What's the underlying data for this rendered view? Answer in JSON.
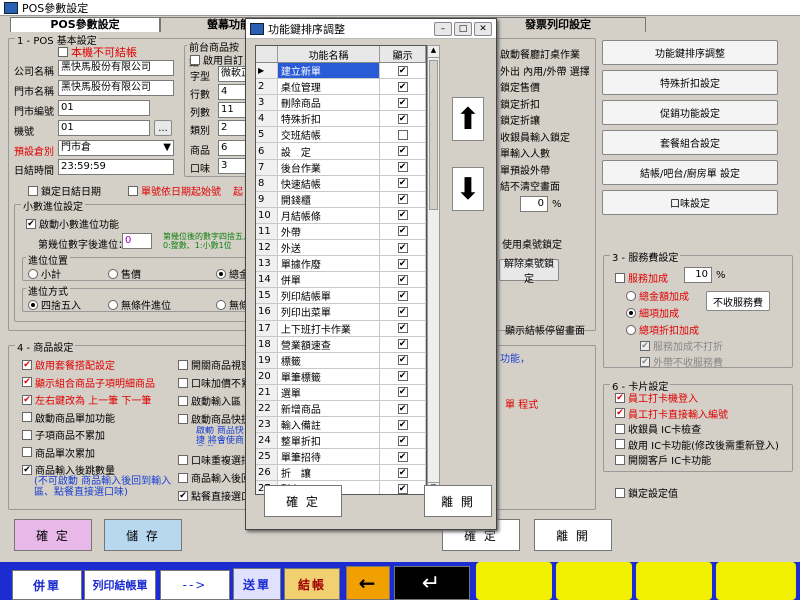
{
  "window": {
    "title": "POS參數設定"
  },
  "tabs": [
    "POS參數設定",
    "螢幕功能設定",
    "",
    "發票列印設定"
  ],
  "section1": {
    "title": "1 - POS 基本設定",
    "not_branch": "本機不可結帳",
    "company_label": "公司名稱",
    "company_value": "黑快馬股份有限公司",
    "store_label": "門市名稱",
    "store_value": "黑快馬股份有限公司",
    "store_no_label": "門市編號",
    "store_no_value": "01",
    "machine_label": "機號",
    "machine_value": "01",
    "warehouse_label": "預設倉別",
    "warehouse_value": "門市倉",
    "daytime_label": "日結時間",
    "daytime_value": "23:59:59",
    "lock_day": "鎖定日結日期",
    "order_day_no": "單號依日期起始號",
    "front_title": "前台商品按鈕",
    "enable_custom": "啟用自訂",
    "font_label": "字型",
    "font_value": "微軟正",
    "rows_label": "行數",
    "rows_value": "4",
    "cols_label": "列數",
    "cols_value": "11",
    "class_label": "類別",
    "class_value": "2",
    "goods_label": "商品",
    "goods_value": "6",
    "taste_label": "口味",
    "taste_value": "3"
  },
  "decimal": {
    "title": "小數進位設定",
    "enable": "啟動小數進位功能",
    "digits_label": "第幾位數字後進位：",
    "digits_value": "0",
    "note": "第幾位後的數字四捨五入 0:整數、1:小數1位",
    "pos_title": "進位位置",
    "pos_options": [
      "小計",
      "售價",
      "總金額"
    ],
    "mode_title": "進位方式",
    "mode_options": [
      "四捨五入",
      "無條件進位",
      "無條件捨去"
    ]
  },
  "section4": {
    "title": "4 - 商品設定",
    "left": [
      {
        "label": "啟用套餐搭配設定",
        "checked": true,
        "red": true
      },
      {
        "label": "顯示組合商品子項明細商品",
        "checked": true,
        "red": true
      },
      {
        "label": "左右鍵改為 上一筆 下一筆",
        "checked": true,
        "red": true
      },
      {
        "label": "啟動商品單加功能",
        "checked": false,
        "red": false
      },
      {
        "label": "子項商品不累加",
        "checked": false,
        "red": false
      },
      {
        "label": "商品單次累加",
        "checked": false,
        "red": false
      },
      {
        "label": "商品輸入後跳數量",
        "checked": true,
        "red": false
      }
    ],
    "left_note": "(不可啟動 商品輸入後回到輸入區、點餐直接選口味)",
    "mid": [
      {
        "label": "開關商品視窗",
        "checked": false
      },
      {
        "label": "口味加價不累計",
        "checked": false
      },
      {
        "label": "啟動輸入區",
        "checked": false
      },
      {
        "label": "啟動商品快捷",
        "checked": false
      },
      {
        "label": "口味重複選擇",
        "checked": false
      },
      {
        "label": "商品輸入後回",
        "checked": false
      },
      {
        "label": "點餐直接選口",
        "checked": true
      }
    ],
    "mid_note": "啟動 商品快捷 將會使商品選"
  },
  "middle_partial": {
    "items": [
      "啟動餐廳訂桌作業",
      "外出 內用/外帶 選擇",
      "鎖定售價",
      "鎖定折扣",
      "鎖定折讓",
      "收銀員輸入鎖定",
      "單輸入人數",
      "單預設外帶",
      "結不清空畫面"
    ],
    "percent_value": "0",
    "use_lock": "使用桌號鎖定",
    "release_btn": "解除桌號鎖定",
    "stop_note": "顯示結帳停留畫面",
    "func_note": "功能，",
    "prog_note": "單 程式"
  },
  "right_buttons": [
    "功能鍵排序調整",
    "特殊折扣設定",
    "促銷功能設定",
    "套餐組合設定",
    "結帳/吧台/廚房單 設定",
    "口味設定"
  ],
  "section3": {
    "title": "3 - 服務費設定",
    "service_label": "服務加成",
    "service_value": "10",
    "percent": "%",
    "options": [
      "總金額加成",
      "細項加成",
      "總項折扣加成"
    ],
    "no_fee_btn": "不收服務費",
    "no_discount": "服務加成不打折",
    "no_takeout": "外帶不收服務費"
  },
  "section6": {
    "title": "6 - 卡片設定",
    "items": [
      {
        "label": "員工打卡機登入",
        "checked": true,
        "red": true
      },
      {
        "label": "員工打卡直接輸入編號",
        "checked": true,
        "red": true
      },
      {
        "label": "收銀員 IC卡檢查",
        "checked": false,
        "red": false
      },
      {
        "label": "啟用 IC卡功能(修改後需重新登入)",
        "checked": false,
        "red": false
      },
      {
        "label": "開關客戶 IC卡功能",
        "checked": false,
        "red": false
      }
    ],
    "lock_settings": "鎖定設定值"
  },
  "footer": {
    "ok": "確 定",
    "save": "儲 存",
    "ok2": "確 定",
    "leave": "離 開"
  },
  "taskbar": {
    "items": [
      "併單",
      "列印結帳單",
      "-->",
      "送單",
      "結帳",
      "←"
    ]
  },
  "dialog": {
    "title": "功能鍵排序調整",
    "col_name": "功能名稱",
    "col_show": "顯示",
    "rows": [
      {
        "n": "1",
        "name": "建立新單",
        "show": true
      },
      {
        "n": "2",
        "name": "桌位管理",
        "show": true
      },
      {
        "n": "3",
        "name": "刪除商品",
        "show": true
      },
      {
        "n": "4",
        "name": "特殊折扣",
        "show": true
      },
      {
        "n": "5",
        "name": "交班結帳",
        "show": false
      },
      {
        "n": "6",
        "name": "設　定",
        "show": true
      },
      {
        "n": "7",
        "name": "後台作業",
        "show": true
      },
      {
        "n": "8",
        "name": "快速結帳",
        "show": true
      },
      {
        "n": "9",
        "name": "開錢櫃",
        "show": true
      },
      {
        "n": "10",
        "name": "月結帳條",
        "show": true
      },
      {
        "n": "11",
        "name": "外帶",
        "show": true
      },
      {
        "n": "12",
        "name": "外送",
        "show": true
      },
      {
        "n": "13",
        "name": "單據作廢",
        "show": true
      },
      {
        "n": "14",
        "name": "併單",
        "show": true
      },
      {
        "n": "15",
        "name": "列印結帳單",
        "show": true
      },
      {
        "n": "16",
        "name": "列印出菜單",
        "show": true
      },
      {
        "n": "17",
        "name": "上下班打卡作業",
        "show": true
      },
      {
        "n": "18",
        "name": "營業額速查",
        "show": true
      },
      {
        "n": "19",
        "name": "標籤",
        "show": true
      },
      {
        "n": "20",
        "name": "單筆標籤",
        "show": true
      },
      {
        "n": "21",
        "name": "選單",
        "show": true
      },
      {
        "n": "22",
        "name": "新增商品",
        "show": true
      },
      {
        "n": "23",
        "name": "輸入備註",
        "show": true
      },
      {
        "n": "24",
        "name": "整單折扣",
        "show": true
      },
      {
        "n": "25",
        "name": "單筆招待",
        "show": true
      },
      {
        "n": "26",
        "name": "折　讓",
        "show": true
      },
      {
        "n": "27",
        "name": "暫存",
        "show": true
      }
    ],
    "ok": "確 定",
    "leave": "離 開"
  }
}
